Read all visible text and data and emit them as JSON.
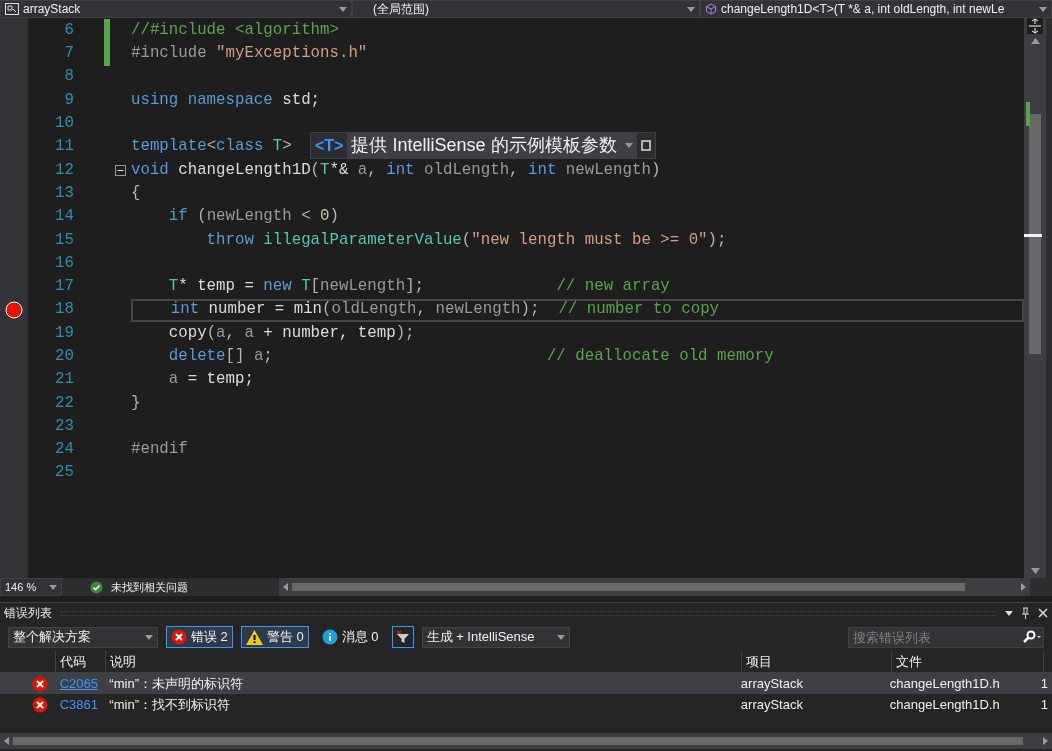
{
  "navigation_bar": {
    "project": "arrayStack",
    "scope": "(全局范围)",
    "member": "changeLength1D<T>(T *& a, int oldLength, int newLe"
  },
  "editor": {
    "lines": [
      {
        "number": "6",
        "changed": true,
        "tokens": [
          {
            "kind": "comment",
            "text": "//#include <algorithm>"
          }
        ]
      },
      {
        "number": "7",
        "changed": true,
        "tokens": [
          {
            "kind": "pre",
            "text": "#include "
          },
          {
            "kind": "string",
            "text": "\"myExceptions.h\""
          }
        ]
      },
      {
        "number": "8"
      },
      {
        "number": "9",
        "tokens": [
          {
            "kind": "kw",
            "text": "using namespace"
          },
          {
            "kind": "plain",
            "text": " std;"
          }
        ]
      },
      {
        "number": "10"
      },
      {
        "number": "11",
        "tokens": [
          {
            "kind": "kw",
            "text": "template"
          },
          {
            "kind": "punct",
            "text": "<"
          },
          {
            "kind": "kw",
            "text": "class"
          },
          {
            "kind": "type",
            "text": " T"
          },
          {
            "kind": "punct",
            "text": ">"
          }
        ]
      },
      {
        "number": "12",
        "expanded": true,
        "tokens": [
          {
            "kind": "kw",
            "text": "void"
          },
          {
            "kind": "plain",
            "text": " changeLength1D"
          },
          {
            "kind": "punct",
            "text": "("
          },
          {
            "kind": "type",
            "text": "T"
          },
          {
            "kind": "plain",
            "text": "*& "
          },
          {
            "kind": "param",
            "text": "a"
          },
          {
            "kind": "punct",
            "text": ", "
          },
          {
            "kind": "kw",
            "text": "int"
          },
          {
            "kind": "param",
            "text": " oldLength"
          },
          {
            "kind": "punct",
            "text": ", "
          },
          {
            "kind": "kw",
            "text": "int"
          },
          {
            "kind": "param",
            "text": " newLength"
          },
          {
            "kind": "punct",
            "text": ")"
          }
        ]
      },
      {
        "number": "13",
        "tokens": [
          {
            "kind": "punct",
            "text": "{"
          }
        ]
      },
      {
        "number": "14",
        "tokens": [
          {
            "kind": "kw",
            "text": "    if"
          },
          {
            "kind": "punct",
            "text": " ("
          },
          {
            "kind": "param",
            "text": "newLength"
          },
          {
            "kind": "punct",
            "text": " < "
          },
          {
            "kind": "num",
            "text": "0"
          },
          {
            "kind": "punct",
            "text": ")"
          }
        ]
      },
      {
        "number": "15",
        "tokens": [
          {
            "kind": "kw",
            "text": "        throw"
          },
          {
            "kind": "type",
            "text": " illegalParameterValue"
          },
          {
            "kind": "punct",
            "text": "("
          },
          {
            "kind": "string",
            "text": "\"new length must be >= 0\""
          },
          {
            "kind": "punct",
            "text": ");"
          }
        ]
      },
      {
        "number": "16"
      },
      {
        "number": "17",
        "tokens": [
          {
            "kind": "type",
            "text": "    T"
          },
          {
            "kind": "plain",
            "text": "* temp = "
          },
          {
            "kind": "kw",
            "text": "new"
          },
          {
            "kind": "type",
            "text": " T"
          },
          {
            "kind": "punct",
            "text": "["
          },
          {
            "kind": "param",
            "text": "newLength"
          },
          {
            "kind": "punct",
            "text": "];              "
          },
          {
            "kind": "comment",
            "text": "// new array"
          }
        ]
      },
      {
        "number": "18",
        "breakpoint": true,
        "current": true,
        "tokens": [
          {
            "kind": "kw",
            "text": "    int"
          },
          {
            "kind": "plain",
            "text": " number = min"
          },
          {
            "kind": "punct",
            "text": "("
          },
          {
            "kind": "param",
            "text": "oldLength"
          },
          {
            "kind": "punct",
            "text": ", "
          },
          {
            "kind": "param",
            "text": "newLength"
          },
          {
            "kind": "punct",
            "text": ");  "
          },
          {
            "kind": "comment",
            "text": "// number to copy"
          }
        ]
      },
      {
        "number": "19",
        "tokens": [
          {
            "kind": "plain",
            "text": "    copy"
          },
          {
            "kind": "punct",
            "text": "("
          },
          {
            "kind": "param",
            "text": "a"
          },
          {
            "kind": "punct",
            "text": ", "
          },
          {
            "kind": "param",
            "text": "a"
          },
          {
            "kind": "plain",
            "text": " + number, temp"
          },
          {
            "kind": "punct",
            "text": ");"
          }
        ]
      },
      {
        "number": "20",
        "tokens": [
          {
            "kind": "kw",
            "text": "    delete"
          },
          {
            "kind": "punct",
            "text": "[] "
          },
          {
            "kind": "param",
            "text": "a"
          },
          {
            "kind": "punct",
            "text": ";                             "
          },
          {
            "kind": "comment",
            "text": "// deallocate old memory"
          }
        ]
      },
      {
        "number": "21",
        "tokens": [
          {
            "kind": "param",
            "text": "    a"
          },
          {
            "kind": "plain",
            "text": " = temp;"
          }
        ]
      },
      {
        "number": "22",
        "tokens": [
          {
            "kind": "punct",
            "text": "}"
          }
        ]
      },
      {
        "number": "23"
      },
      {
        "number": "24",
        "tokens": [
          {
            "kind": "pre",
            "text": "#endif"
          }
        ]
      },
      {
        "number": "25"
      }
    ],
    "tooltip": {
      "tag": "<T>",
      "text": "提供 IntelliSense 的示例模板参数"
    }
  },
  "status_bar": {
    "zoom": "146 %",
    "health": "未找到相关问题"
  },
  "error_list": {
    "title": "错误列表",
    "scope": "整个解决方案",
    "filters": [
      {
        "kind": "error",
        "label": "错误 2",
        "selected": true
      },
      {
        "kind": "warning",
        "label": "警告 0",
        "selected": true
      },
      {
        "kind": "info",
        "label": "消息 0",
        "selected": false
      }
    ],
    "source": "生成 + IntelliSense",
    "search": {
      "placeholder": "搜索错误列表"
    },
    "columns": [
      "代码",
      "说明",
      "项目",
      "文件"
    ],
    "rows": [
      {
        "selected": true,
        "code": "C2065",
        "visited": true,
        "description": "“min”：未声明的标识符",
        "project": "arrayStack",
        "file": "changeLength1D.h",
        "column_6": "1"
      },
      {
        "selected": false,
        "code": "C3861",
        "visited": false,
        "description": "“min”：找不到标识符",
        "project": "arrayStack",
        "file": "changeLength1D.h",
        "column_6": "1"
      }
    ]
  }
}
